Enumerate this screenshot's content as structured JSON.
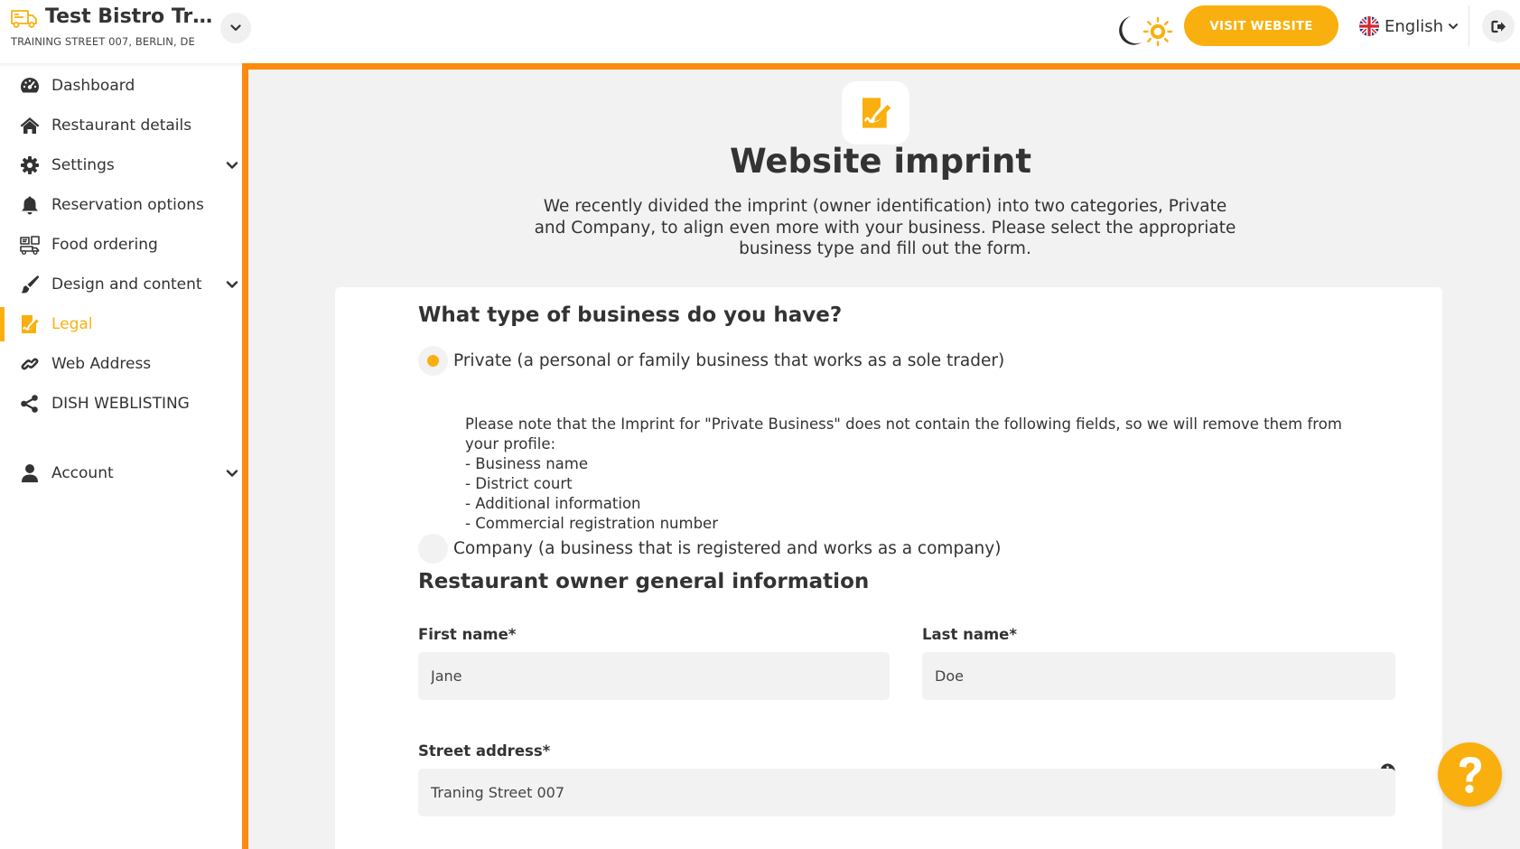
{
  "header": {
    "restaurant_name": "Test Bistro Training",
    "restaurant_address": "TRAINING STREET 007, BERLIN, DE",
    "visit_button": "VISIT WEBSITE",
    "language": "English"
  },
  "sidebar": {
    "items": [
      {
        "label": "Dashboard",
        "icon": "dashboard-icon"
      },
      {
        "label": "Restaurant details",
        "icon": "home-icon"
      },
      {
        "label": "Settings",
        "icon": "gear-icon",
        "expandable": true
      },
      {
        "label": "Reservation options",
        "icon": "bell-icon"
      },
      {
        "label": "Food ordering",
        "icon": "food-ordering-icon"
      },
      {
        "label": "Design and content",
        "icon": "brush-icon",
        "expandable": true
      },
      {
        "label": "Legal",
        "icon": "legal-icon",
        "active": true
      },
      {
        "label": "Web Address",
        "icon": "link-icon"
      },
      {
        "label": "DISH WEBLISTING",
        "icon": "share-icon"
      },
      {
        "label": "Account",
        "icon": "user-icon",
        "expandable": true
      }
    ]
  },
  "page": {
    "title": "Website imprint",
    "intro": "We recently divided the imprint (owner identification) into two categories, Private and Company, to align even more with your business. Please select the appropriate business type and fill out the form.",
    "business_type_question": "What type of business do you have?",
    "options": {
      "private": {
        "label": "Private (a personal or family business that works as a sole trader)",
        "selected": true
      },
      "company": {
        "label": "Company (a business that is registered and works as a company)",
        "selected": false
      }
    },
    "private_note": {
      "intro": "Please note that the Imprint for \"Private Business\" does not contain the following fields, so we will remove them from your profile:",
      "fields": [
        "Business name",
        "District court",
        "Additional information",
        "Commercial registration number"
      ]
    },
    "owner_section_title": "Restaurant owner general information",
    "form": {
      "first_name": {
        "label": "First name*",
        "value": "Jane"
      },
      "last_name": {
        "label": "Last name*",
        "value": "Doe"
      },
      "street_address": {
        "label": "Street address*",
        "value": "Traning Street 007"
      }
    }
  },
  "colors": {
    "accent": "#f9b00f",
    "border_orange": "#fb8a0e",
    "background": "#f2f2f2",
    "text": "#333333"
  }
}
